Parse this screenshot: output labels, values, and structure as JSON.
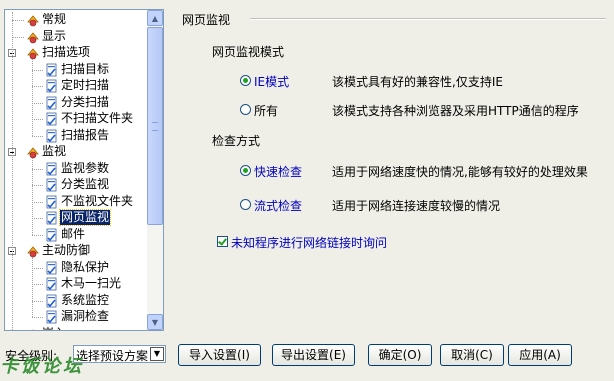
{
  "tree": {
    "items": [
      {
        "label": "常规",
        "level": 1,
        "icon": "settings-icon"
      },
      {
        "label": "显示",
        "level": 1,
        "icon": "display-icon"
      },
      {
        "label": "扫描选项",
        "level": 1,
        "icon": "scan-icon",
        "expanded": true
      },
      {
        "label": "扫描目标",
        "level": 2,
        "icon": "document-check-icon"
      },
      {
        "label": "定时扫描",
        "level": 2,
        "icon": "document-check-icon"
      },
      {
        "label": "分类扫描",
        "level": 2,
        "icon": "document-check-icon"
      },
      {
        "label": "不扫描文件夹",
        "level": 2,
        "icon": "document-check-icon"
      },
      {
        "label": "扫描报告",
        "level": 2,
        "icon": "document-check-icon"
      },
      {
        "label": "监视",
        "level": 1,
        "icon": "monitor-icon",
        "expanded": true
      },
      {
        "label": "监视参数",
        "level": 2,
        "icon": "document-check-icon"
      },
      {
        "label": "分类监视",
        "level": 2,
        "icon": "document-check-icon"
      },
      {
        "label": "不监视文件夹",
        "level": 2,
        "icon": "document-check-icon"
      },
      {
        "label": "网页监视",
        "level": 2,
        "icon": "document-check-icon",
        "selected": true
      },
      {
        "label": "邮件",
        "level": 2,
        "icon": "document-check-icon"
      },
      {
        "label": "主动防御",
        "level": 1,
        "icon": "shield-icon",
        "expanded": true
      },
      {
        "label": "隐私保护",
        "level": 2,
        "icon": "document-check-icon"
      },
      {
        "label": "木马一扫光",
        "level": 2,
        "icon": "document-check-icon"
      },
      {
        "label": "系统监控",
        "level": 2,
        "icon": "document-check-icon"
      },
      {
        "label": "漏洞检查",
        "level": 2,
        "icon": "document-check-icon"
      },
      {
        "label": "嵌入",
        "level": 1,
        "icon": "embed-icon"
      }
    ],
    "scroll_up": "▲",
    "scroll_down": "▼"
  },
  "panel": {
    "title": "网页监视",
    "mode_group": {
      "heading": "网页监视模式",
      "options": [
        {
          "label": "IE模式",
          "description": "该模式具有好的兼容性,仅支持IE",
          "selected": true
        },
        {
          "label": "所有",
          "description": "该模式支持各种浏览器及采用HTTP通信的程序",
          "selected": false
        }
      ]
    },
    "check_group": {
      "heading": "检查方式",
      "options": [
        {
          "label": "快速检查",
          "description": "适用于网络速度快的情况,能够有较好的处理效果",
          "selected": true
        },
        {
          "label": "流式检查",
          "description": "适用于网络连接速度较慢的情况",
          "selected": false
        }
      ]
    },
    "ask_checkbox": {
      "label": "未知程序进行网络链接时询问",
      "checked": true
    }
  },
  "footer": {
    "security_label": "安全级别:",
    "security_select": "选择预设方案",
    "buttons": {
      "import": "导入设置(I)",
      "export": "导出设置(E)",
      "ok": "确定(O)",
      "cancel": "取消(C)",
      "apply": "应用(A)"
    },
    "watermark": "卡饭论坛"
  },
  "colors": {
    "selection": "#0a246a",
    "link_text": "#0000c0",
    "radio_dot": "#21a121",
    "window_bg": "#efefe7"
  }
}
